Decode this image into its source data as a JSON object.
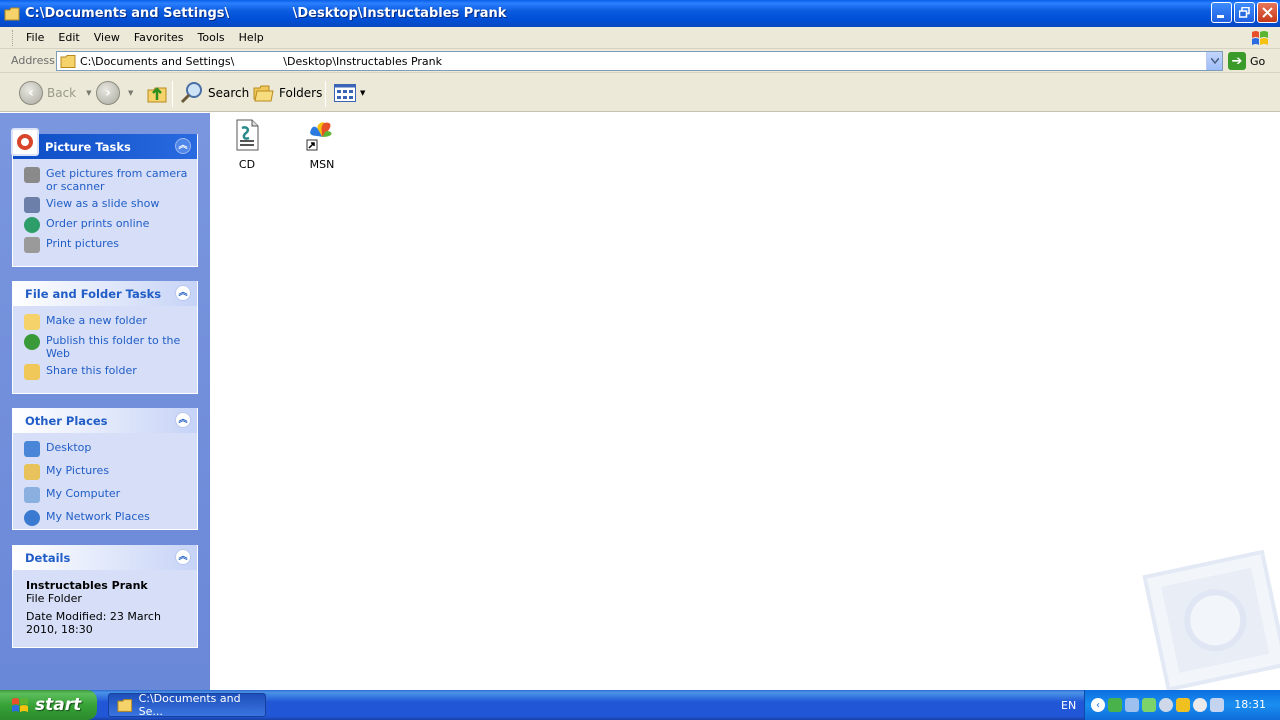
{
  "window": {
    "title": "C:\\Documents and Settings\\              \\Desktop\\Instructables Prank"
  },
  "menu": [
    "File",
    "Edit",
    "View",
    "Favorites",
    "Tools",
    "Help"
  ],
  "address": {
    "label": "Address",
    "value": "C:\\Documents and Settings\\              \\Desktop\\Instructables Prank",
    "go_label": "Go"
  },
  "toolbar": {
    "back": "Back",
    "search": "Search",
    "folders": "Folders"
  },
  "panels": {
    "picture_tasks": {
      "title": "Picture Tasks",
      "items": [
        "Get pictures from camera or scanner",
        "View as a slide show",
        "Order prints online",
        "Print pictures"
      ]
    },
    "file_folder_tasks": {
      "title": "File and Folder Tasks",
      "items": [
        "Make a new folder",
        "Publish this folder to the Web",
        "Share this folder"
      ]
    },
    "other_places": {
      "title": "Other Places",
      "items": [
        "Desktop",
        "My Pictures",
        "My Computer",
        "My Network Places"
      ]
    },
    "details": {
      "title": "Details",
      "name": "Instructables Prank",
      "type": "File Folder",
      "modified": "Date Modified: 23 March 2010, 18:30"
    }
  },
  "files": [
    {
      "label": "CD",
      "icon": "script-file-icon"
    },
    {
      "label": "MSN",
      "icon": "msn-shortcut-icon"
    }
  ],
  "taskbar": {
    "start": "start",
    "task_label": "C:\\Documents and Se...",
    "lang": "EN",
    "clock": "18:31"
  }
}
